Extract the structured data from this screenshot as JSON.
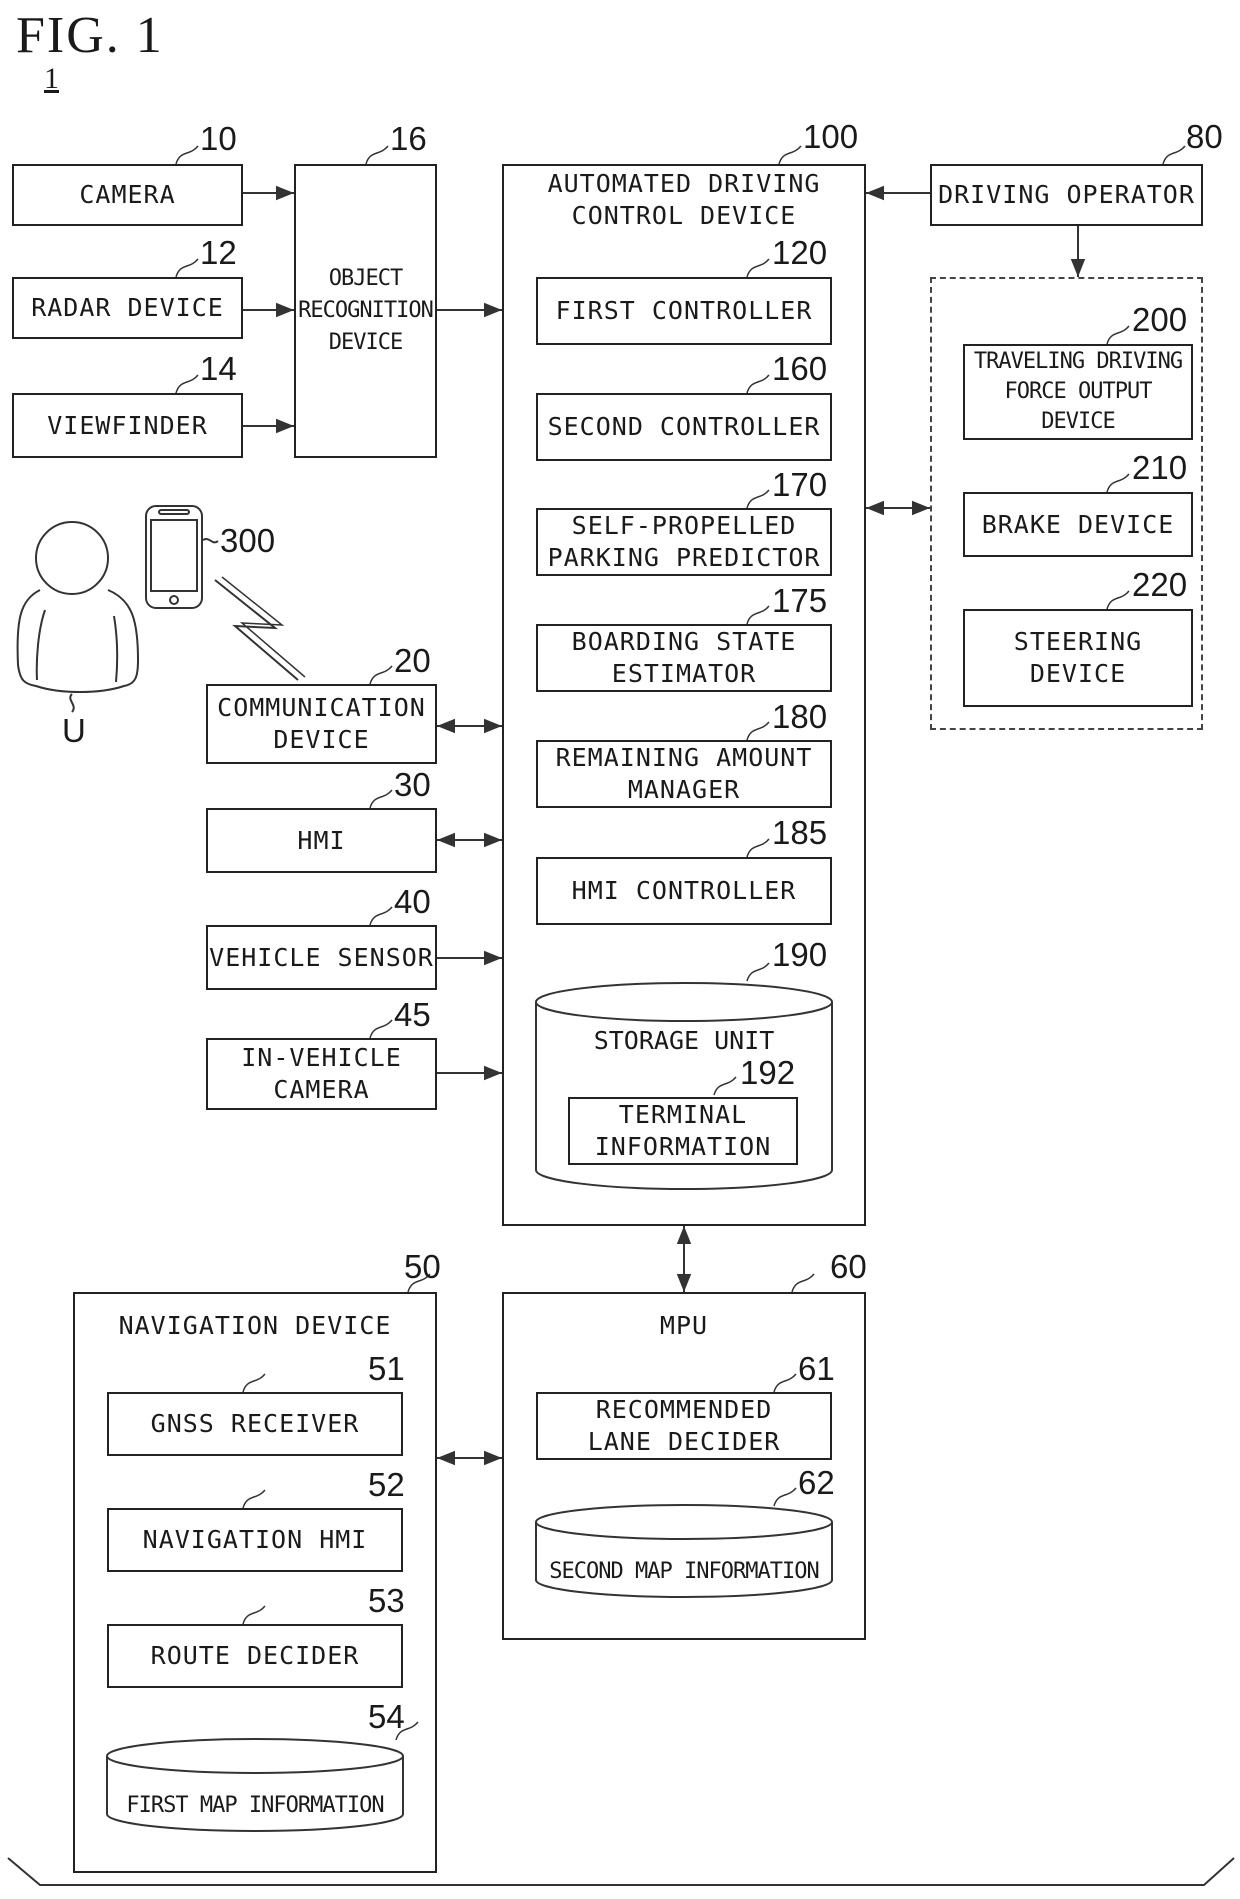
{
  "figure": {
    "title": "FIG. 1",
    "system_ref": "1"
  },
  "sensors": [
    {
      "ref": "10",
      "label": "CAMERA"
    },
    {
      "ref": "12",
      "label": "RADAR DEVICE"
    },
    {
      "ref": "14",
      "label": "VIEWFINDER"
    }
  ],
  "object_recognition": {
    "ref": "16",
    "label": "OBJECT\nRECOGNITION\nDEVICE"
  },
  "automated_driving": {
    "ref": "100",
    "title": "AUTOMATED DRIVING\nCONTROL DEVICE",
    "components": [
      {
        "ref": "120",
        "label": "FIRST CONTROLLER"
      },
      {
        "ref": "160",
        "label": "SECOND CONTROLLER"
      },
      {
        "ref": "170",
        "label": "SELF-PROPELLED\nPARKING PREDICTOR"
      },
      {
        "ref": "175",
        "label": "BOARDING STATE\nESTIMATOR"
      },
      {
        "ref": "180",
        "label": "REMAINING AMOUNT\nMANAGER"
      },
      {
        "ref": "185",
        "label": "HMI CONTROLLER"
      }
    ],
    "storage": {
      "ref": "190",
      "label": "STORAGE UNIT",
      "inner": {
        "ref": "192",
        "label": "TERMINAL\nINFORMATION"
      }
    }
  },
  "driving_operator": {
    "ref": "80",
    "label": "DRIVING OPERATOR"
  },
  "actuators": [
    {
      "ref": "200",
      "label": "TRAVELING DRIVING\nFORCE OUTPUT\nDEVICE"
    },
    {
      "ref": "210",
      "label": "BRAKE DEVICE"
    },
    {
      "ref": "220",
      "label": "STEERING\nDEVICE"
    }
  ],
  "user": {
    "ref": "U"
  },
  "terminal": {
    "ref": "300"
  },
  "vehicle_devices": [
    {
      "ref": "20",
      "label": "COMMUNICATION\nDEVICE"
    },
    {
      "ref": "30",
      "label": "HMI"
    },
    {
      "ref": "40",
      "label": "VEHICLE SENSOR"
    },
    {
      "ref": "45",
      "label": "IN-VEHICLE\nCAMERA"
    }
  ],
  "navigation": {
    "ref": "50",
    "title": "NAVIGATION DEVICE",
    "components": [
      {
        "ref": "51",
        "label": "GNSS RECEIVER"
      },
      {
        "ref": "52",
        "label": "NAVIGATION HMI"
      },
      {
        "ref": "53",
        "label": "ROUTE DECIDER"
      }
    ],
    "map": {
      "ref": "54",
      "label": "FIRST MAP INFORMATION"
    }
  },
  "mpu": {
    "ref": "60",
    "title": "MPU",
    "component": {
      "ref": "61",
      "label": "RECOMMENDED\nLANE DECIDER"
    },
    "map": {
      "ref": "62",
      "label": "SECOND MAP INFORMATION"
    }
  }
}
